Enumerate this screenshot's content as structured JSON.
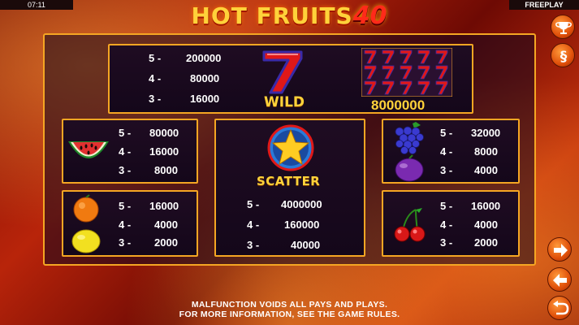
{
  "status": {
    "time": "07:11",
    "mode": "FREEPLAY"
  },
  "logo": {
    "text": "HOT FRUITS",
    "number": "40"
  },
  "wild": {
    "label": "WILD",
    "pays": [
      {
        "count": "5 -",
        "value": "200000"
      },
      {
        "count": "4 -",
        "value": "80000"
      },
      {
        "count": "3 -",
        "value": "16000"
      }
    ],
    "full_screen_win": "8000000"
  },
  "scatter": {
    "label": "SCATTER",
    "pays": [
      {
        "count": "5 -",
        "value": "4000000"
      },
      {
        "count": "4 -",
        "value": "160000"
      },
      {
        "count": "3 -",
        "value": "40000"
      }
    ]
  },
  "watermelon": {
    "pays": [
      {
        "count": "5 -",
        "value": "80000"
      },
      {
        "count": "4 -",
        "value": "16000"
      },
      {
        "count": "3 -",
        "value": "8000"
      }
    ]
  },
  "orange_lemon": {
    "pays": [
      {
        "count": "5 -",
        "value": "16000"
      },
      {
        "count": "4 -",
        "value": "4000"
      },
      {
        "count": "3 -",
        "value": "2000"
      }
    ]
  },
  "grapes_plum": {
    "pays": [
      {
        "count": "5 -",
        "value": "32000"
      },
      {
        "count": "4 -",
        "value": "8000"
      },
      {
        "count": "3 -",
        "value": "4000"
      }
    ]
  },
  "cherries": {
    "pays": [
      {
        "count": "5 -",
        "value": "16000"
      },
      {
        "count": "4 -",
        "value": "4000"
      },
      {
        "count": "3 -",
        "value": "2000"
      }
    ]
  },
  "footer": {
    "line1": "MALFUNCTION VOIDS ALL PAYS AND PLAYS.",
    "line2": "FOR MORE INFORMATION, SEE THE GAME RULES."
  },
  "side_buttons": [
    "trophy-icon",
    "section-icon",
    "next-arrow-icon",
    "prev-arrow-icon",
    "back-icon"
  ]
}
